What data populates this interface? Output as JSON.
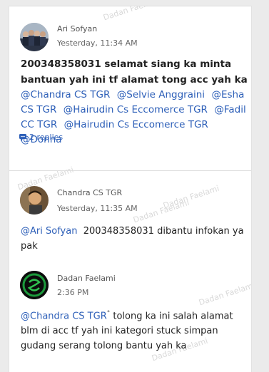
{
  "watermark": "Dadan Faelami",
  "posts": [
    {
      "author": "Ari Sofyan",
      "time": "Yesterday, 11:34 AM",
      "text": "200348358031 selamat siang ka minta bantuan yah ini tf alamat tong acc yah ka",
      "mentions": [
        "@Chandra CS TGR",
        "@Selvie Anggraini",
        "@Esha CS TGR",
        "@Hairudin Cs Eccomerce TGR",
        "@Fadil CC TGR",
        "@Hairudin Cs Eccomerce TGR",
        "@Donna"
      ],
      "replies": "2 replies"
    },
    {
      "author": "Chandra CS TGR",
      "time": "Yesterday, 11:35 AM",
      "mention": "@Ari Sofyan",
      "text": "200348358031 dibantu infokan ya pak"
    },
    {
      "author": "Dadan Faelami",
      "time": "2:36 PM",
      "mention": "@Chandra CS TGR",
      "text": "tolong ka ini salah alamat blm di acc tf yah ini kategori stuck simpan gudang serang tolong bantu yah ka"
    }
  ]
}
